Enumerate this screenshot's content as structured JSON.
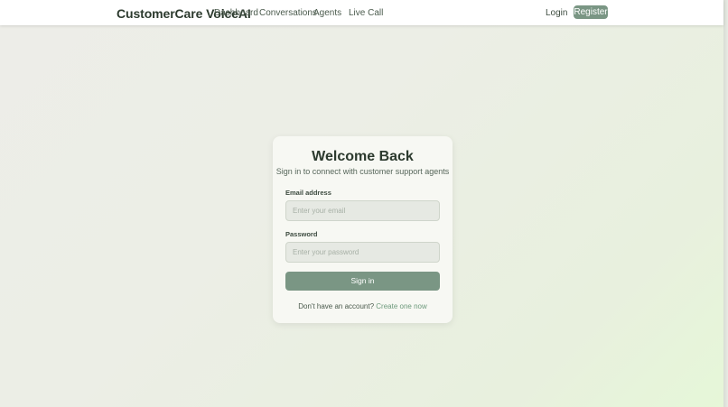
{
  "navbar": {
    "brand": "CustomerCare VoiceAI",
    "links": [
      "Dashboard",
      "Conversations",
      "Agents",
      "Live Call"
    ],
    "login_label": "Login",
    "register_label": "Register"
  },
  "login_card": {
    "title": "Welcome Back",
    "subtitle": "Sign in to connect with customer support agents",
    "email": {
      "label": "Email address",
      "placeholder": "Enter your email",
      "value": ""
    },
    "password": {
      "label": "Password",
      "placeholder": "Enter your password",
      "value": ""
    },
    "submit_label": "Sign in",
    "footer_prompt": "Don't have an account?",
    "footer_link": "Create one now"
  },
  "colors": {
    "accent": "#7a9684",
    "link": "#6d9a7c",
    "heading": "#2c3a2e"
  }
}
